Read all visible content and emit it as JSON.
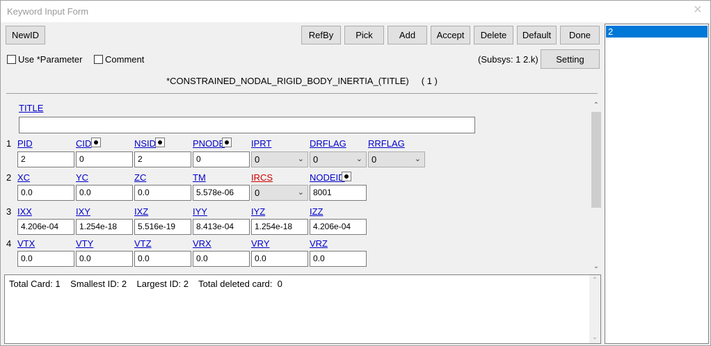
{
  "window": {
    "title": "Keyword Input Form"
  },
  "toolbar": {
    "newid": "NewID",
    "refby": "RefBy",
    "pick": "Pick",
    "add": "Add",
    "accept": "Accept",
    "delete": "Delete",
    "default": "Default",
    "done": "Done",
    "setting": "Setting"
  },
  "options": {
    "use_parameter": "Use *Parameter",
    "comment": "Comment",
    "subsys": "(Subsys: 1 2.k)"
  },
  "keyword": {
    "name": "*CONSTRAINED_NODAL_RIGID_BODY_INERTIA_(TITLE)",
    "count": "( 1 )"
  },
  "title_field": {
    "label": "TITLE",
    "value": ""
  },
  "cards": [
    {
      "num": "1",
      "fields": [
        {
          "label": "PID",
          "value": "2",
          "type": "input"
        },
        {
          "label": "CID",
          "value": "0",
          "type": "input",
          "picker": true
        },
        {
          "label": "NSID",
          "value": "2",
          "type": "input",
          "picker": true
        },
        {
          "label": "PNODE",
          "value": "0",
          "type": "input",
          "picker": true
        },
        {
          "label": "IPRT",
          "value": "0",
          "type": "select"
        },
        {
          "label": "DRFLAG",
          "value": "0",
          "type": "select"
        },
        {
          "label": "RRFLAG",
          "value": "0",
          "type": "select"
        }
      ]
    },
    {
      "num": "2",
      "fields": [
        {
          "label": "XC",
          "value": "0.0",
          "type": "input"
        },
        {
          "label": "YC",
          "value": "0.0",
          "type": "input"
        },
        {
          "label": "ZC",
          "value": "0.0",
          "type": "input"
        },
        {
          "label": "TM",
          "value": "5.578e-06",
          "type": "input"
        },
        {
          "label": "IRCS",
          "value": "0",
          "type": "select",
          "color": "#cc0000"
        },
        {
          "label": "NODEID",
          "value": "8001",
          "type": "input",
          "picker": true
        }
      ]
    },
    {
      "num": "3",
      "fields": [
        {
          "label": "IXX",
          "value": "4.206e-04",
          "type": "input"
        },
        {
          "label": "IXY",
          "value": "1.254e-18",
          "type": "input"
        },
        {
          "label": "IXZ",
          "value": "5.516e-19",
          "type": "input"
        },
        {
          "label": "IYY",
          "value": "8.413e-04",
          "type": "input"
        },
        {
          "label": "IYZ",
          "value": "1.254e-18",
          "type": "input"
        },
        {
          "label": "IZZ",
          "value": "4.206e-04",
          "type": "input"
        }
      ]
    },
    {
      "num": "4",
      "fields": [
        {
          "label": "VTX",
          "value": "0.0",
          "type": "input"
        },
        {
          "label": "VTY",
          "value": "0.0",
          "type": "input"
        },
        {
          "label": "VTZ",
          "value": "0.0",
          "type": "input"
        },
        {
          "label": "VRX",
          "value": "0.0",
          "type": "input"
        },
        {
          "label": "VRY",
          "value": "0.0",
          "type": "input"
        },
        {
          "label": "VRZ",
          "value": "0.0",
          "type": "input"
        }
      ]
    }
  ],
  "info": {
    "text": "Total Card: 1    Smallest ID: 2    Largest ID: 2    Total deleted card:  0"
  },
  "id_list": {
    "items": [
      "2"
    ],
    "selected": "2"
  },
  "icons": {
    "close": "close-icon",
    "scroll_up": "chevron-up-icon",
    "scroll_down": "chevron-down-icon",
    "dropdown": "chevron-down-icon",
    "picker": "dot-picker-icon"
  },
  "colors": {
    "selection": "#0078d7",
    "link": "#0000cc",
    "required": "#cc0000"
  }
}
